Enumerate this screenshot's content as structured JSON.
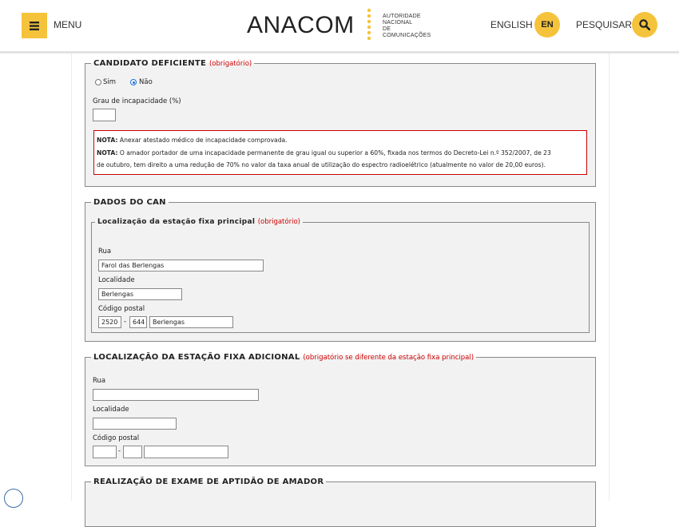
{
  "header": {
    "menu_label": "MENU",
    "logo_text": "ANACOM",
    "logo_sub": [
      "AUTORIDADE",
      "NACIONAL",
      "DE COMUNICAÇÕES"
    ],
    "language_label": "ENGLISH",
    "language_code": "EN",
    "search_label": "PESQUISAR",
    "accent_color": "#f5c33b"
  },
  "deficiente": {
    "legend": "CANDIDATO DEFICIENTE",
    "required": "(obrigatório)",
    "option_yes": "Sim",
    "option_no": "Não",
    "selected": "Não",
    "grau_label": "Grau de incapacidade (%)",
    "grau_value": "",
    "note1_prefix": "NOTA:",
    "note1_text": " Anexar atestado médico de incapacidade comprovada.",
    "note2_prefix": "NOTA:",
    "note2_text_line1": " O amador portador de uma incapacidade permanente de grau igual ou superior a 60%, fixada nos termos do Decreto-Lei n.º 352/2007, de 23",
    "note2_text_line2": "de outubro, tem direito a uma redução de 70% no valor da taxa anual de utilização do espectro radioelétrico (atualmente no valor de 20,00 euros)."
  },
  "can": {
    "legend": "DADOS DO CAN",
    "principal": {
      "legend": "Localização da estação fixa principal",
      "required": "(obrigatório)",
      "rua_label": "Rua",
      "rua_value": "Farol das Berlengas",
      "localidade_label": "Localidade",
      "localidade_value": "Berlengas",
      "codigo_label": "Código postal",
      "codigo_part1": "2520",
      "codigo_part2": "644",
      "codigo_locality": "Berlengas",
      "separator": "-"
    }
  },
  "adicional": {
    "legend": "LOCALIZAÇÃO DA ESTAÇÃO FIXA ADICIONAL",
    "required": "(obrigatório se diferente da estação fixa principal)",
    "rua_label": "Rua",
    "rua_value": "",
    "localidade_label": "Localidade",
    "localidade_value": "",
    "codigo_label": "Código postal",
    "codigo_part1": "",
    "codigo_part2": "",
    "codigo_locality": "",
    "separator": "-"
  },
  "exame": {
    "legend": "REALIZAÇÃO DE EXAME DE APTIDÃO DE AMADOR"
  }
}
